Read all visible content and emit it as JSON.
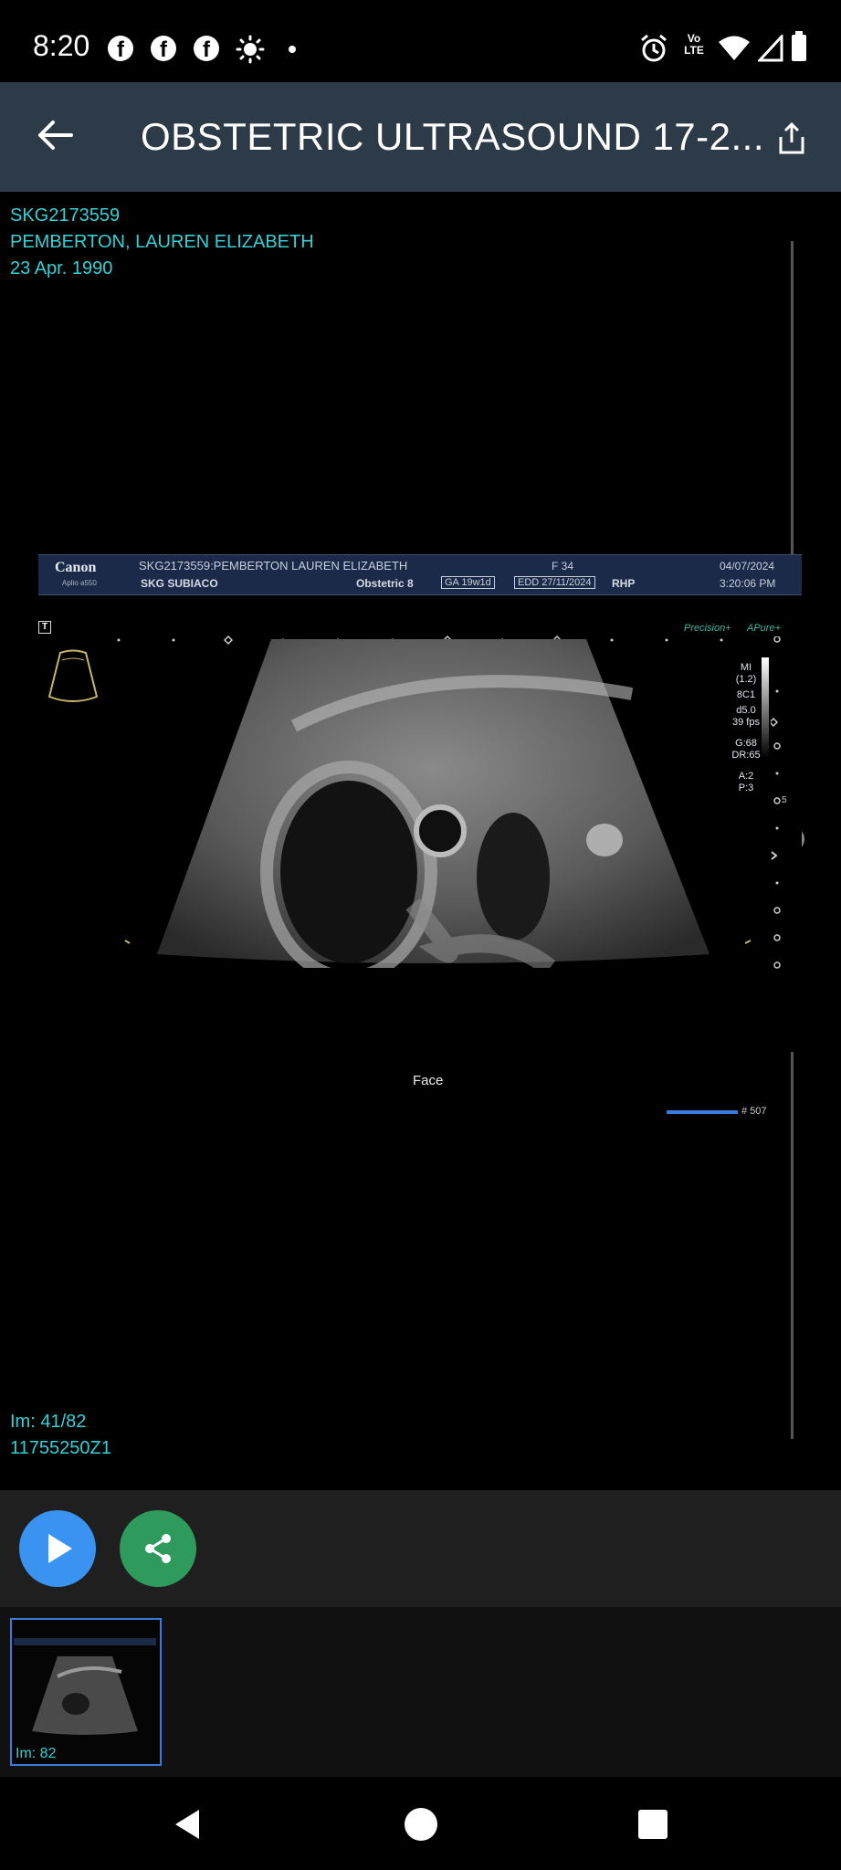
{
  "status_bar": {
    "time": "8:20",
    "notification_icons": [
      "facebook-icon",
      "facebook-icon",
      "facebook-icon",
      "brightness-icon"
    ],
    "status_icons": [
      "alarm-icon",
      "volte-icon",
      "wifi-icon",
      "signal-icon",
      "battery-icon"
    ],
    "volte_label": "Vo LTE"
  },
  "toolbar": {
    "title": "OBSTETRIC ULTRASOUND 17-2...",
    "back_icon": "arrow-left-icon",
    "share_icon": "share-export-icon",
    "background": "#2d3a48"
  },
  "patient": {
    "id": "SKG2173559",
    "name": "PEMBERTON, LAUREN ELIZABETH",
    "dob": "23 Apr. 1990"
  },
  "image_info": {
    "index": "Im: 41/82",
    "accession": "11755250Z1"
  },
  "ultrasound": {
    "header": {
      "brand": "Canon",
      "model": "Aplio a550",
      "patient_line": "SKG2173559:PEMBERTON LAUREN ELIZABETH",
      "sex_age": "F  34",
      "date": "04/07/2024",
      "site": "SKG SUBIACO",
      "preset": "Obstetric 8",
      "ga": "GA 19w1d",
      "edd": "EDD 27/11/2024",
      "hospital": "RHP",
      "time": "3:20:06 PM"
    },
    "t_marker": "T",
    "badges": [
      "Precision+",
      "APure+"
    ],
    "params": [
      "MI",
      "(1.2)",
      "8C1",
      "d5.0",
      "39 fps",
      "G:68",
      "DR:65",
      "A:2",
      "P:3"
    ],
    "depth_mark": "5",
    "label": "Face",
    "frame_count": "# 507",
    "accent": "#3a7be0"
  },
  "actions": {
    "play_icon": "play-icon",
    "share_icon": "share-nodes-icon",
    "play_color": "#3a93f0",
    "share_color": "#2e9a5c"
  },
  "thumbnails": [
    {
      "label": "Im: 82",
      "selected": true
    }
  ],
  "nav": {
    "back_icon": "nav-back-icon",
    "home_icon": "nav-home-icon",
    "recents_icon": "nav-recents-icon"
  },
  "colors": {
    "info_text": "#33d1d6",
    "action_bar": "#1f1f1f"
  }
}
